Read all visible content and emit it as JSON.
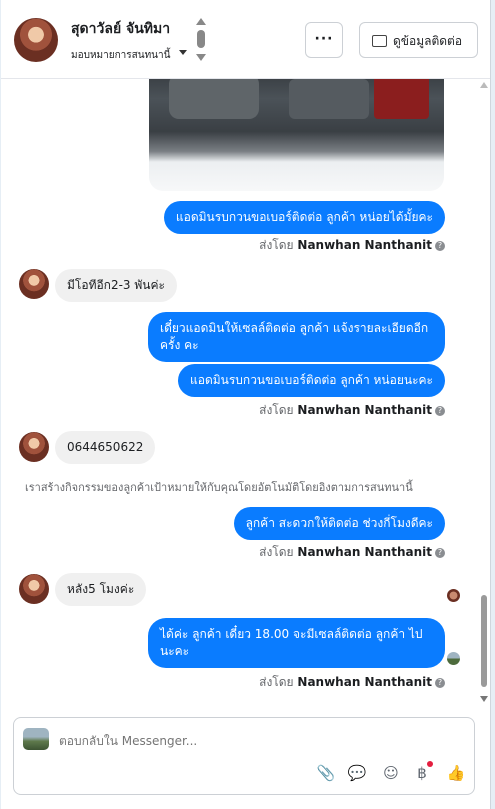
{
  "header": {
    "contact_name": "สุดาวัลย์ จันทิมา",
    "assign_label": "มอบหมายการสนทนานี้",
    "more_label": "···",
    "contact_info_label": "ดูข้อมูลติดต่อ"
  },
  "messages": [
    {
      "kind": "image",
      "alt": "engine-photo"
    },
    {
      "kind": "out",
      "text": "แอดมินรบกวนขอเบอร์ติดต่อ ลูกค้า หน่อยได้มั้ยคะ"
    },
    {
      "kind": "sent",
      "prefix": "ส่งโดย",
      "agent": "Nanwhan Nanthanit"
    },
    {
      "kind": "in",
      "text": "มีโอทีอีก2-3 พันค่ะ"
    },
    {
      "kind": "out",
      "text": "เดี๋ยวแอดมินให้เซลล์ติดต่อ ลูกค้า แจ้งรายละเอียดอีกครั้ง คะ"
    },
    {
      "kind": "out",
      "text": "แอดมินรบกวนขอเบอร์ติดต่อ ลูกค้า หน่อยนะคะ"
    },
    {
      "kind": "sent",
      "prefix": "ส่งโดย",
      "agent": "Nanwhan Nanthanit"
    },
    {
      "kind": "in",
      "text": "0644650622"
    },
    {
      "kind": "notice",
      "text": "เราสร้างกิจกรรมของลูกค้าเป้าหมายให้กับคุณโดยอัตโนมัติโดยอิงตามการสนทนานี้"
    },
    {
      "kind": "out",
      "text": "ลูกค้า สะดวกให้ติดต่อ ช่วงกี่โมงดีคะ"
    },
    {
      "kind": "sent",
      "prefix": "ส่งโดย",
      "agent": "Nanwhan Nanthanit"
    },
    {
      "kind": "in",
      "text": "หลัง5 โมงค่ะ"
    },
    {
      "kind": "out",
      "text": "ได้ค่ะ  ลูกค้า เดี๋ยว 18.00 จะมีเซลล์ติดต่อ ลูกค้า ไปนะคะ"
    },
    {
      "kind": "sent",
      "prefix": "ส่งโดย",
      "agent": "Nanwhan Nanthanit"
    }
  ],
  "composer": {
    "placeholder": "ตอบกลับใน Messenger..."
  },
  "tools": [
    {
      "icon": "paperclip-icon",
      "glyph": "📎"
    },
    {
      "icon": "chat-bubble-icon",
      "glyph": "💬"
    },
    {
      "icon": "smiley-icon",
      "glyph": "☺"
    },
    {
      "icon": "baht-icon",
      "glyph": "฿"
    },
    {
      "icon": "thumbs-up-icon",
      "glyph": "👍"
    }
  ],
  "colors": {
    "outgoing": "#0a7cff",
    "incoming": "#f0f0f0"
  }
}
